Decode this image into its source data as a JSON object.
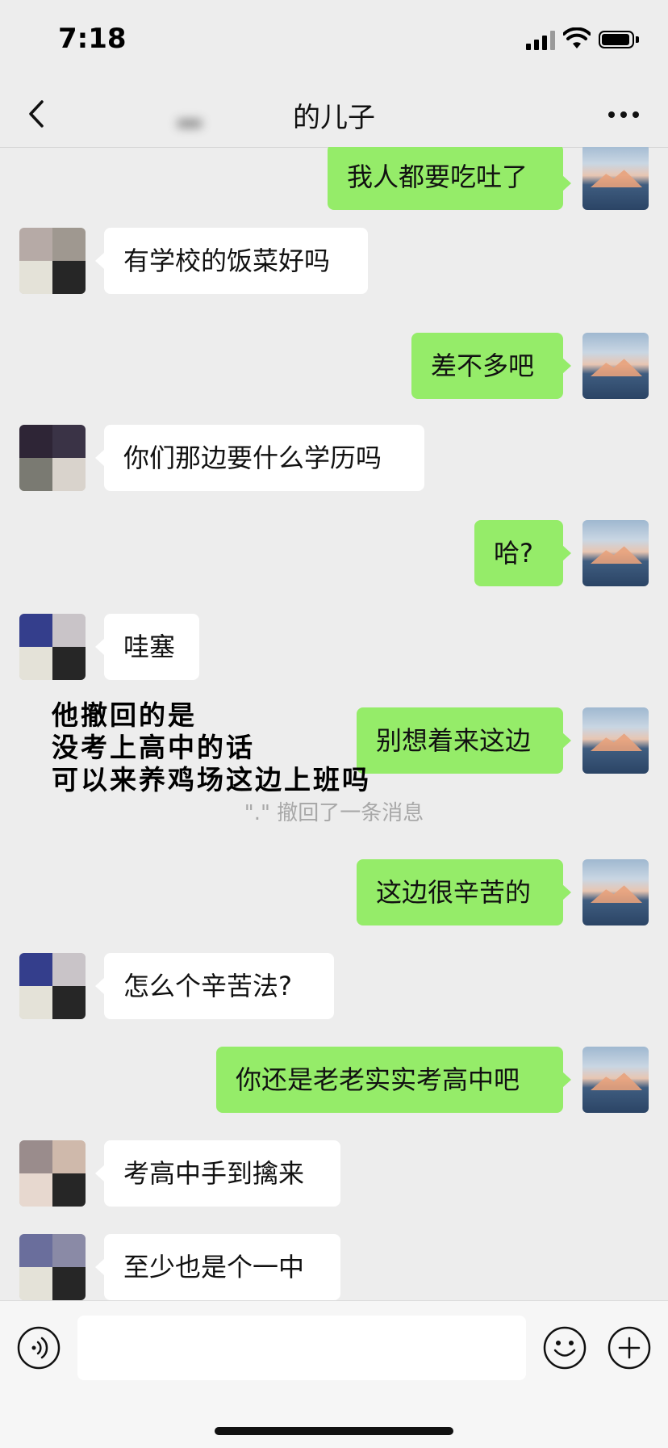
{
  "status_bar": {
    "time": "7:18"
  },
  "nav": {
    "title": "的儿子"
  },
  "messages": [
    {
      "side": "me",
      "text": "我人都要吃吐了"
    },
    {
      "side": "other",
      "text": "有学校的饭菜好吗"
    },
    {
      "side": "me",
      "text": "差不多吧"
    },
    {
      "side": "other",
      "text": "你们那边要什么学历吗"
    },
    {
      "side": "me",
      "text": "哈?"
    },
    {
      "side": "other",
      "text": "哇塞"
    },
    {
      "side": "me",
      "text": "别想着来这边"
    },
    {
      "side": "me",
      "text": "这边很辛苦的"
    },
    {
      "side": "other",
      "text": "怎么个辛苦法?"
    },
    {
      "side": "me",
      "text": "你还是老老实实考高中吧"
    },
    {
      "side": "other",
      "text": "考高中手到擒来"
    },
    {
      "side": "other",
      "text": "至少也是个一中"
    }
  ],
  "recall_notice": "\".\" 撤回了一条消息",
  "annotation": {
    "line1": "他撤回的是",
    "line2": "没考上高中的话",
    "line3": "可以来养鸡场这边上班吗"
  },
  "input": {
    "value": "",
    "placeholder": ""
  },
  "colors": {
    "bubble_me": "#95ec69",
    "bubble_other": "#ffffff",
    "background": "#ededed"
  },
  "icons": {
    "back": "chevron-left-icon",
    "more": "more-dots-icon",
    "voice": "voice-icon",
    "emoji": "emoji-icon",
    "plus": "plus-icon"
  }
}
